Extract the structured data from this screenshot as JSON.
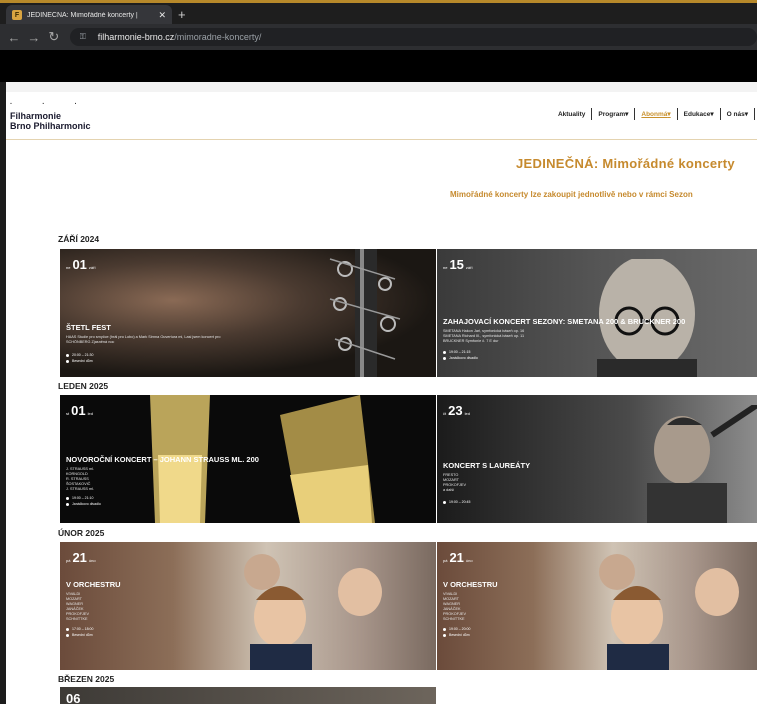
{
  "browser": {
    "tab_title": "JEDINEČNÁ: Mimořádné koncerty | ",
    "tab_favicon": "F",
    "url_domain": "filharmonie-brno.cz",
    "url_path": "/mimoradne-koncerty/"
  },
  "site": {
    "logo_line1": "Filharmonie",
    "logo_line2": "Brno Philharmonic",
    "menu": [
      "Aktuality",
      "Program",
      "Abonmá",
      "Edukace",
      "O nás"
    ]
  },
  "page": {
    "title": "JEDINEČNÁ: Mimořádné koncerty",
    "subtitle": "Mimořádné koncerty lze zakoupit jednotlivě nebo v rámci Sezon"
  },
  "months": [
    {
      "label": "ZÁŘÍ 2024",
      "events": [
        {
          "day": "01",
          "weekday": "ne",
          "month_abbr": "září",
          "title": "ŠTETL FEST",
          "desc": [
            "HAAS Studie pro smyčce (hrál pro Lobo) a Mark Sirnna Ouvertura mi, Lasi jsem koncert pro",
            "SCHÖNBERG Zjasněná noc"
          ],
          "time": "20:00 – 21:30",
          "venue": "Besední dům"
        },
        {
          "day": "15",
          "weekday": "ne",
          "month_abbr": "září",
          "title": "ZAHAJOVACÍ KONCERT SEZONY: SMETANA 200 & BRUCKNER 200",
          "desc": [
            "SMETANA Hakon Jarl, symfonická báseň op. 16",
            "SMETANA Richard III., symfonická báseň op. 11",
            "BRUCKNER Symfonie č. 7 E dur"
          ],
          "time": "19:00 – 21:15",
          "venue": "Janáčkovo divadlo"
        }
      ]
    },
    {
      "label": "LEDEN 2025",
      "events": [
        {
          "day": "01",
          "weekday": "st",
          "month_abbr": "led",
          "title": "NOVOROČNÍ KONCERT – JOHANN STRAUSS ML. 200",
          "desc": [
            "J. STRAUSS ml.",
            "KORNGOLD",
            "R. STRAUSS",
            "ŠOSTAKOVIČ",
            "J. STRAUSS ml."
          ],
          "time": "19:00 – 21:10",
          "venue": "Janáčkovo divadlo"
        },
        {
          "day": "23",
          "weekday": "čt",
          "month_abbr": "led",
          "title": "KONCERT S LAUREÁTY",
          "desc": [
            "FRESTO",
            "MOZART",
            "PROKOFJEV",
            "a další"
          ],
          "time": "19:00 – 20:45",
          "venue": ""
        }
      ]
    },
    {
      "label": "ÚNOR 2025",
      "events": [
        {
          "day": "21",
          "weekday": "pá",
          "month_abbr": "úno",
          "title": "V ORCHESTRU",
          "desc": [
            "VIVALDI",
            "MOZART",
            "WAGNER",
            "JANÁČEK",
            "PROKOFJEV",
            "SCHNITTKE"
          ],
          "time": "17:00 – 18:00",
          "venue": "Besední dům"
        },
        {
          "day": "21",
          "weekday": "pá",
          "month_abbr": "úno",
          "title": "V ORCHESTRU",
          "desc": [
            "VIVALDI",
            "MOZART",
            "WAGNER",
            "JANÁČEK",
            "PROKOFJEV",
            "SCHNITTKE"
          ],
          "time": "19:00 – 20:00",
          "venue": "Besední dům"
        }
      ]
    },
    {
      "label": "BŘEZEN 2025",
      "events": [
        {
          "day": "06"
        }
      ]
    }
  ],
  "colors": {
    "accent": "#c68a2e",
    "tab_accent": "#d9a441"
  }
}
